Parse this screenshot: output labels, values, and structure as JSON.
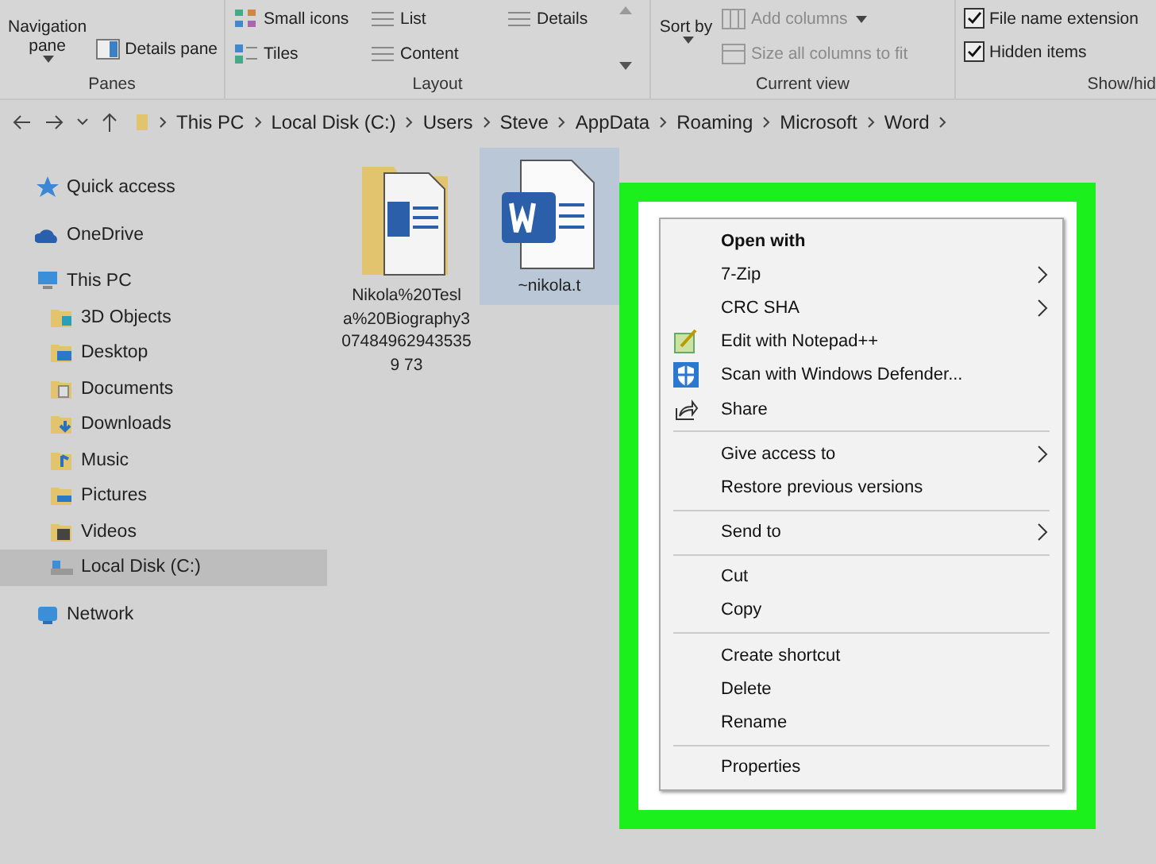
{
  "ribbon": {
    "groups": [
      {
        "kind": "panes",
        "label": "Panes",
        "large_button": "Navigation pane",
        "items": [
          {
            "label": "Details pane"
          }
        ]
      },
      {
        "kind": "layout",
        "label": "Layout",
        "items": [
          {
            "label": "Small icons"
          },
          {
            "label": "List"
          },
          {
            "label": "Details"
          },
          {
            "label": "Tiles"
          },
          {
            "label": "Content"
          }
        ]
      },
      {
        "kind": "current_view",
        "label": "Current view",
        "large_button": "Sort by",
        "items": [
          {
            "label": "Add columns",
            "disabled": true,
            "dropdown": true
          },
          {
            "label": "Size all columns to fit",
            "disabled": true,
            "dropdown": false
          }
        ]
      },
      {
        "kind": "show_hide",
        "label": "Show/hid",
        "items": [
          {
            "label": "File name extension",
            "checked": true
          },
          {
            "label": "Hidden items",
            "checked": true
          }
        ]
      }
    ]
  },
  "address_bar": {
    "path": [
      "This PC",
      "Local Disk (C:)",
      "Users",
      "Steve",
      "AppData",
      "Roaming",
      "Microsoft",
      "Word"
    ]
  },
  "sidebar": {
    "items": [
      {
        "label": "Quick access",
        "selected": false
      },
      {
        "label": "OneDrive",
        "selected": false
      },
      {
        "label": "This PC",
        "selected": false,
        "children": [
          {
            "label": "3D Objects",
            "selected": false
          },
          {
            "label": "Desktop",
            "selected": false
          },
          {
            "label": "Documents",
            "selected": false
          },
          {
            "label": "Downloads",
            "selected": false
          },
          {
            "label": "Music",
            "selected": false
          },
          {
            "label": "Pictures",
            "selected": false
          },
          {
            "label": "Videos",
            "selected": false
          },
          {
            "label": "Local Disk (C:)",
            "selected": true
          }
        ]
      },
      {
        "label": "Network",
        "selected": false
      }
    ]
  },
  "files": [
    {
      "kind": "folder",
      "name": "Nikola%20Tesla%20Biography3074849629435359 73",
      "selected": false
    },
    {
      "kind": "document",
      "name": "~nikola.t",
      "selected": true
    }
  ],
  "context_menu": {
    "items": [
      {
        "kind": "default",
        "label": "Open with"
      },
      {
        "kind": "submenu",
        "label": "7-Zip"
      },
      {
        "kind": "submenu",
        "label": "CRC SHA"
      },
      {
        "kind": "notepad",
        "label": "Edit with Notepad++"
      },
      {
        "kind": "defender",
        "label": "Scan with Windows Defender..."
      },
      {
        "kind": "share",
        "label": "Share"
      },
      {
        "kind": "separator"
      },
      {
        "kind": "submenu",
        "label": "Give access to"
      },
      {
        "kind": "plain",
        "label": "Restore previous versions"
      },
      {
        "kind": "separator"
      },
      {
        "kind": "submenu",
        "label": "Send to"
      },
      {
        "kind": "separator"
      },
      {
        "kind": "plain",
        "label": "Cut"
      },
      {
        "kind": "plain",
        "label": "Copy"
      },
      {
        "kind": "separator"
      },
      {
        "kind": "plain",
        "label": "Create shortcut"
      },
      {
        "kind": "plain",
        "label": "Delete"
      },
      {
        "kind": "plain",
        "label": "Rename"
      },
      {
        "kind": "separator"
      },
      {
        "kind": "plain",
        "label": "Properties"
      }
    ]
  }
}
